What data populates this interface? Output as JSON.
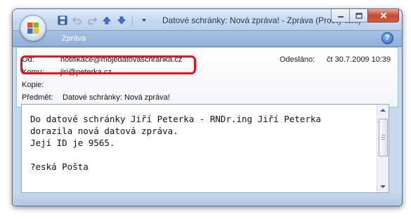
{
  "window": {
    "title": "Datové schránky: Nová zpráva! - Zpráva (Prostý text)"
  },
  "quick_access": {
    "icons": [
      "save-icon",
      "undo-icon",
      "redo-icon",
      "arrow-up-icon",
      "arrow-down-icon",
      "customize-dropdown-icon"
    ]
  },
  "ribbon": {
    "tab_label": "Zpráva"
  },
  "header": {
    "from_label": "Od:",
    "from_value": "notifikace@mojedatovaschranka.cz",
    "sent_label": "Odesláno:",
    "sent_value": "čt 30.7.2009 10:39",
    "to_label": "Komu:",
    "to_value": "jiri@peterka.cz",
    "cc_label": "Kopie:",
    "cc_value": "",
    "subject_label": "Předmět:",
    "subject_value": "Datové schránky: Nová zpráva!"
  },
  "message": {
    "line1": "Do datové schránky Jiří Peterka - RNDr.ing Jiří Peterka",
    "line2": "dorazila nová datová zpráva.",
    "line3": "Její ID je 9565.",
    "line4": "",
    "line5": "?eská Pošta"
  },
  "colors": {
    "highlight": "#e4121c",
    "titlebar": "#c6d8ef",
    "ribbon": "#8fb0da"
  }
}
